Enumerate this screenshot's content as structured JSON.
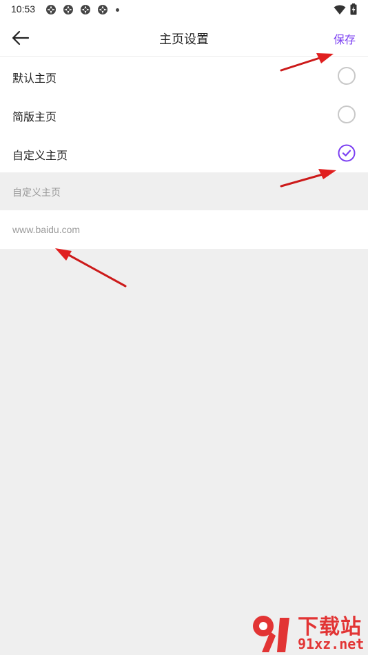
{
  "status_bar": {
    "time": "10:53",
    "notification_icons": [
      "app-notification-icon",
      "app-notification-icon",
      "app-notification-icon",
      "app-notification-icon"
    ],
    "system_icons": [
      "wifi-icon",
      "battery-charging-icon"
    ]
  },
  "header": {
    "title": "主页设置",
    "back_icon": "arrow-left-icon",
    "save_label": "保存"
  },
  "options": [
    {
      "label": "默认主页",
      "checked": false
    },
    {
      "label": "简版主页",
      "checked": false
    },
    {
      "label": "自定义主页",
      "checked": true
    }
  ],
  "custom_section": {
    "title": "自定义主页",
    "url_placeholder": "www.baidu.com"
  },
  "watermark": {
    "top_text": "下载站",
    "bottom_text": "91xz.net"
  },
  "colors": {
    "accent": "#7b3ff2",
    "annotation_arrow": "#e01f1f",
    "background": "#efefef"
  }
}
